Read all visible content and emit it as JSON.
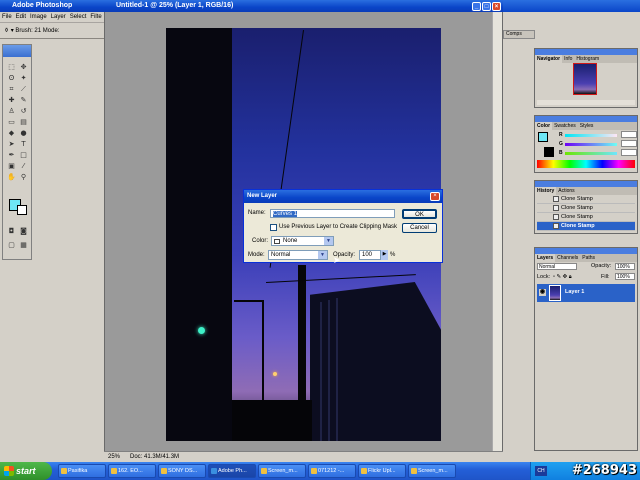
{
  "app": {
    "title": "Adobe Photoshop",
    "menus": [
      "File",
      "Edit",
      "Image",
      "Layer",
      "Select",
      "Filte"
    ],
    "options_bar": {
      "brush_label": "Brush:",
      "brush_size": "21",
      "mode_label": "Mode:"
    }
  },
  "document": {
    "title": "Untitled-1 @ 25% (Layer 1, RGB/16)",
    "zoom": "25%",
    "doc_size": "Doc: 41.3M/41.3M"
  },
  "right_options": {
    "combs_tab": "Comps"
  },
  "panels": {
    "navigator": {
      "tabs": [
        "Navigator",
        "Info",
        "Histogram"
      ]
    },
    "color": {
      "tabs": [
        "Color",
        "Swatches",
        "Styles"
      ],
      "sliders": [
        {
          "label": "R",
          "value": ""
        },
        {
          "label": "G",
          "value": ""
        },
        {
          "label": "B",
          "value": ""
        }
      ],
      "fg_color": "#6ee6f5"
    },
    "history": {
      "tabs": [
        "History",
        "Actions"
      ],
      "items": [
        {
          "label": "Clone Stamp",
          "selected": false
        },
        {
          "label": "Clone Stamp",
          "selected": false
        },
        {
          "label": "Clone Stamp",
          "selected": false
        },
        {
          "label": "Clone Stamp",
          "selected": true
        }
      ]
    },
    "layers": {
      "tabs": [
        "Layers",
        "Channels",
        "Paths"
      ],
      "blend_mode": "Normal",
      "opacity_label": "Opacity:",
      "opacity_value": "100%",
      "lock_label": "Lock:",
      "fill_label": "Fill:",
      "fill_value": "100%",
      "layer_name": "Layer 1"
    }
  },
  "dialog": {
    "title": "New Layer",
    "name_label": "Name:",
    "name_value": "Curves 1",
    "ok_label": "OK",
    "cancel_label": "Cancel",
    "clip_label": "Use Previous Layer to Create Clipping Mask",
    "color_label": "Color:",
    "color_value": "None",
    "mode_label": "Mode:",
    "mode_value": "Normal",
    "opacity_label": "Opacity:",
    "opacity_value": "100",
    "opacity_unit": "%"
  },
  "taskbar": {
    "start_label": "start",
    "tasks": [
      {
        "label": "Pasifika",
        "active": false
      },
      {
        "label": "162. EO...",
        "active": false
      },
      {
        "label": "SONY DS...",
        "active": false
      },
      {
        "label": "Adobe Ph...",
        "active": true
      },
      {
        "label": "Screen_m...",
        "active": false
      },
      {
        "label": "071212 -...",
        "active": false
      },
      {
        "label": "Flickr Upl...",
        "active": false
      },
      {
        "label": "Screen_m...",
        "active": false
      }
    ],
    "tray_lang": "CH",
    "watermark": "#268943"
  }
}
